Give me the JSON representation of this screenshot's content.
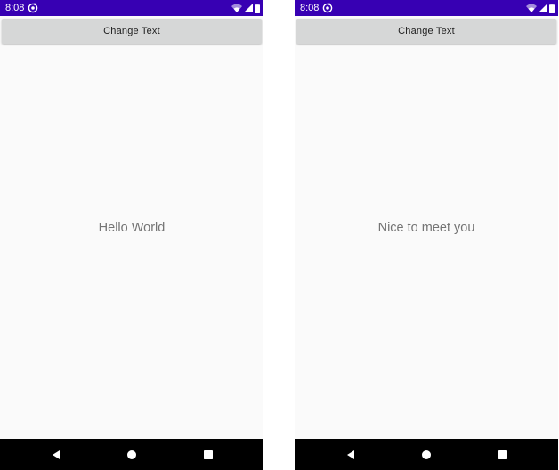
{
  "screens": [
    {
      "status": {
        "time": "8:08"
      },
      "button": {
        "label": "Change Text"
      },
      "message": "Hello World"
    },
    {
      "status": {
        "time": "8:08"
      },
      "button": {
        "label": "Change Text"
      },
      "message": "Nice to meet you"
    }
  ],
  "icons": {
    "status_app": "sync-status-icon",
    "wifi": "wifi-icon",
    "signal": "cell-signal-icon",
    "battery": "battery-icon",
    "back": "nav-back-icon",
    "home": "nav-home-icon",
    "recents": "nav-recents-icon"
  },
  "colors": {
    "status_bar": "#3700b3",
    "screen_background": "#fafafa",
    "button_background": "#d6d7d7",
    "message_text": "#747474",
    "nav_bar": "#000000"
  }
}
